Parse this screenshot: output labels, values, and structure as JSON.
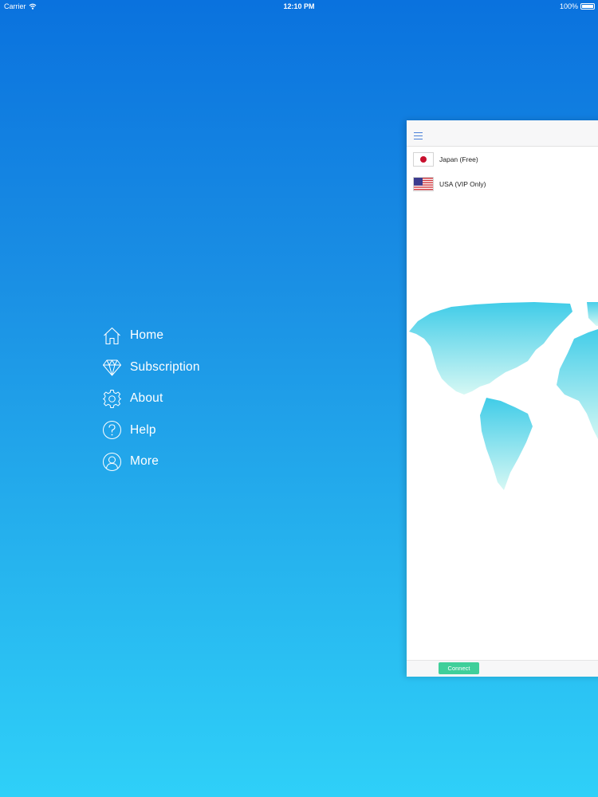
{
  "status_bar": {
    "carrier": "Carrier",
    "time": "12:10 PM",
    "battery": "100%"
  },
  "menu": {
    "items": [
      {
        "label": "Home",
        "icon": "home-icon"
      },
      {
        "label": "Subscription",
        "icon": "diamond-icon"
      },
      {
        "label": "About",
        "icon": "gear-icon"
      },
      {
        "label": "Help",
        "icon": "question-icon"
      },
      {
        "label": "More",
        "icon": "user-icon"
      }
    ]
  },
  "panel": {
    "servers": [
      {
        "name": "Japan (Free)",
        "flag": "japan-flag"
      },
      {
        "name": "USA (VIP Only)",
        "flag": "usa-flag"
      }
    ],
    "connect_label": "Connect"
  },
  "colors": {
    "accent": "#3fcf9a",
    "map": "#48d2ec",
    "background_top": "#0a72de",
    "background_bottom": "#2fd0f8"
  }
}
